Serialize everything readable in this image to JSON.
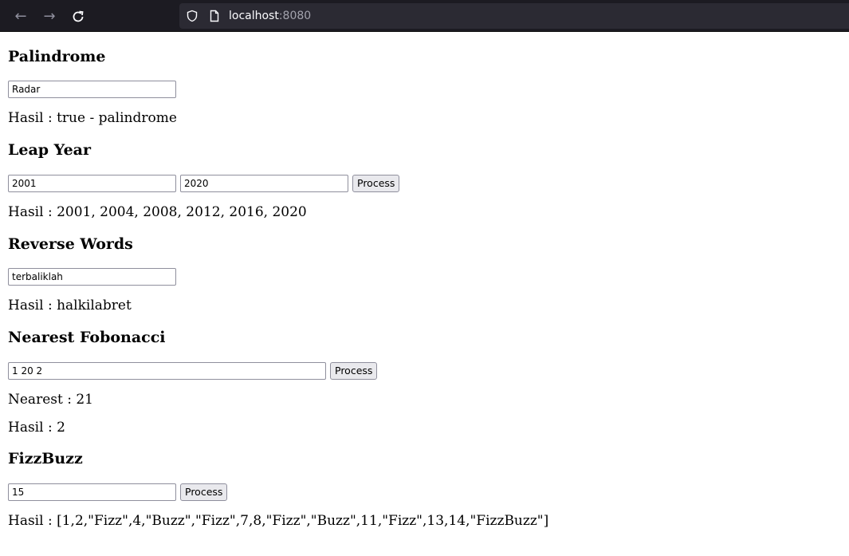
{
  "browser": {
    "url_host": "localhost",
    "url_port": ":8080"
  },
  "palindrome": {
    "title": "Palindrome",
    "input_value": "Radar",
    "result": "Hasil : true - palindrome"
  },
  "leap_year": {
    "title": "Leap Year",
    "start_value": "2001",
    "end_value": "2020",
    "process_label": "Process",
    "result": "Hasil : 2001, 2004, 2008, 2012, 2016, 2020"
  },
  "reverse_words": {
    "title": "Reverse Words",
    "input_value": "terbaliklah",
    "result": "Hasil : halkilabret"
  },
  "nearest_fibonacci": {
    "title": "Nearest Fobonacci",
    "input_value": "1 20 2",
    "process_label": "Process",
    "nearest": "Nearest : 21",
    "result": "Hasil : 2"
  },
  "fizzbuzz": {
    "title": "FizzBuzz",
    "input_value": "15",
    "process_label": "Process",
    "result": "Hasil : [1,2,\"Fizz\",4,\"Buzz\",\"Fizz\",7,8,\"Fizz\",\"Buzz\",11,\"Fizz\",13,14,\"FizzBuzz\"]"
  }
}
